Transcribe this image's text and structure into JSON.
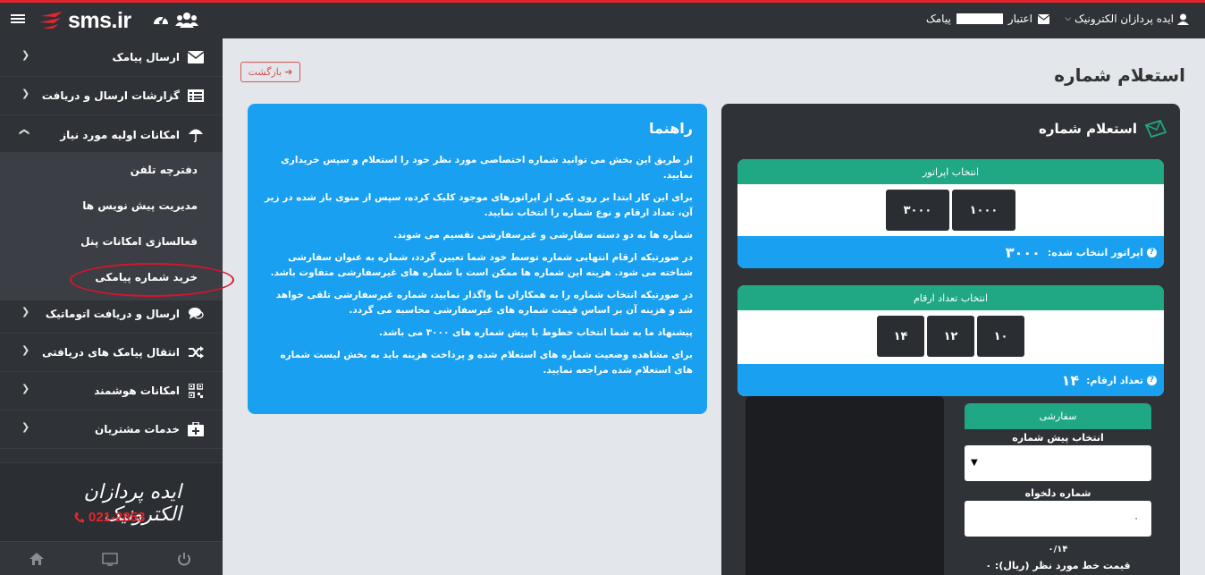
{
  "header": {
    "logo_text": "sms.ir",
    "user_name": "ایده پردازان الکترونیک",
    "credit_label": "اعتبار",
    "credit_unit": "پیامک"
  },
  "sidebar": {
    "items": [
      {
        "label": "ارسال پیامک",
        "icon": "envelope-icon"
      },
      {
        "label": "گزارشات ارسال و دریافت",
        "icon": "list-icon"
      },
      {
        "label": "امکانات اولیه مورد نیاز",
        "icon": "umbrella-icon"
      },
      {
        "label": "ارسال و دریافت اتوماتیک",
        "icon": "chat-icon"
      },
      {
        "label": "انتقال پیامک های دریافتی",
        "icon": "shuffle-icon"
      },
      {
        "label": "امکانات هوشمند",
        "icon": "qrcode-icon"
      },
      {
        "label": "خدمات مشتریان",
        "icon": "medkit-icon"
      }
    ],
    "submenu": [
      {
        "label": "دفترچه تلفن"
      },
      {
        "label": "مدیریت پیش نویس ها"
      },
      {
        "label": "فعالسازی امکانات پنل"
      },
      {
        "label": "خرید شماره پیامکی"
      }
    ],
    "brand_name": "ایده پردازان الکترونیک",
    "brand_phone": "021-2853"
  },
  "page": {
    "title": "استعلام شماره",
    "back_label": "بازگشت"
  },
  "guide": {
    "title": "راهنما",
    "paragraphs": [
      "از طریق این بخش می توانید شماره اختصاصی مورد نظر خود را استعلام و سپس خریداری نمایید.",
      "برای این کار ابتدا بر روی یکی از اپراتورهای موجود کلیک کرده، سپس از منوی باز شده در زیر آن، تعداد ارقام و نوع شماره را انتخاب نمایید.",
      "شماره ها به دو دسته سفارشی و غیرسفارشی تقسیم می شوند.",
      "در صورتیکه ارقام انتهایی شماره توسط خود شما تعیین گردد، شماره به عنوان سفارشی شناخته می شود. هزینه این شماره ها ممکن است با شماره های غیرسفارشی متفاوت باشد.",
      "در صورتیکه انتخاب شماره را به همکاران ما واگذار نمایید، شماره غیرسفارشی تلقی خواهد شد و هزینه آن بر اساس قیمت شماره های غیرسفارشی محاسبه می گردد.",
      "پیشنهاد ما به شما انتخاب خطوط با پیش شماره های ۳۰۰۰ می باشد.",
      "برای مشاهده وضعیت شماره های استعلام شده و پرداخت هزینه باید به بخش لیست شماره های استعلام شده مراجعه نمایید."
    ]
  },
  "panel": {
    "title": "استعلام شماره",
    "operator": {
      "head": "انتخاب اپراتور",
      "options": [
        "۳۰۰۰",
        "۱۰۰۰"
      ],
      "selected_label": "اپراتور انتخاب شده:",
      "selected_value": "۳۰۰۰"
    },
    "digits": {
      "head": "انتخاب تعداد ارقام",
      "options": [
        "۱۴",
        "۱۲",
        "۱۰"
      ],
      "selected_label": "تعداد ارقام:",
      "selected_value": "۱۴"
    },
    "order": {
      "head": "سفارشی",
      "prefix_label": "انتخاب پیش شماره",
      "desired_label": "شماره دلخواه",
      "desired_value": "۰",
      "counter": "۰/۱۴",
      "price_label": "قیمت خط مورد نظر (ریال): ۰"
    }
  },
  "colors": {
    "accent_green": "#1fa883",
    "accent_blue": "#1aa0f0",
    "brand_red": "#e3262e",
    "dark": "#2f3237"
  }
}
